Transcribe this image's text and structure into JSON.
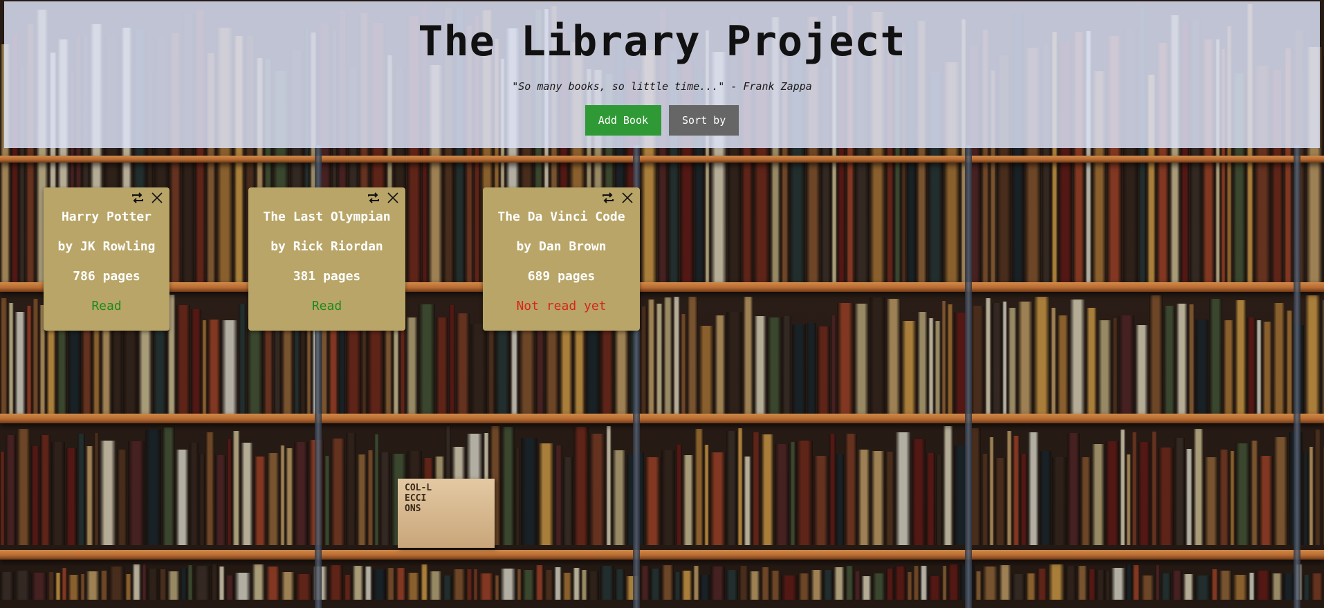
{
  "header": {
    "title": "The Library Project",
    "quote": "\"So many books, so little time...\" - Frank Zappa",
    "add_button_label": "Add Book",
    "sort_button_label": "Sort by"
  },
  "books": [
    {
      "title": "Harry Potter",
      "author_line": "by JK Rowling",
      "pages_line": "786 pages",
      "status": "Read",
      "status_color": "#1b8a1b",
      "toggle_icon": "swap-icon",
      "remove_icon": "close-icon"
    },
    {
      "title": "The Last Olympian",
      "author_line": "by Rick Riordan",
      "pages_line": "381 pages",
      "status": "Read",
      "status_color": "#1b8a1b",
      "toggle_icon": "swap-icon",
      "remove_icon": "close-icon"
    },
    {
      "title": "The Da Vinci Code",
      "author_line": "by Dan Brown",
      "pages_line": "689 pages",
      "status": "Not read yet",
      "status_color": "#d6261a",
      "toggle_icon": "swap-icon",
      "remove_icon": "close-icon"
    }
  ],
  "colors": {
    "header_overlay": "#dee4f8",
    "card_background": "#b8a567",
    "add_button": "#2f9a35",
    "sort_button": "#666666"
  },
  "background": {
    "box_label": "COL-L\nECCI\nONS"
  }
}
